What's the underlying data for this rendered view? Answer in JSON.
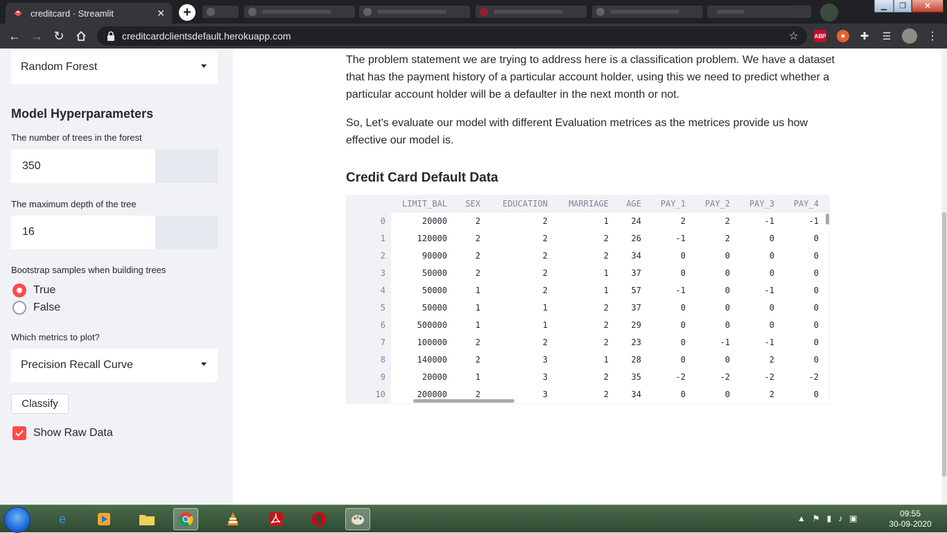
{
  "browser": {
    "tab_title": "creditcard · Streamlit",
    "tab_close": "✕",
    "new_tab": "+",
    "url": "creditcardclientsdefault.herokuapp.com",
    "extensions": {
      "abp": "ABP"
    }
  },
  "sidebar": {
    "classifier_select": "Random Forest",
    "hyperparams_heading": "Model Hyperparameters",
    "trees_label": "The number of trees in the forest",
    "trees_value": "350",
    "depth_label": "The maximum depth of the tree",
    "depth_value": "16",
    "bootstrap_label": "Bootstrap samples when building trees",
    "bootstrap_options": [
      "True",
      "False"
    ],
    "bootstrap_selected": "True",
    "metrics_label": "Which metrics to plot?",
    "metrics_select": "Precision Recall Curve",
    "classify_button": "Classify",
    "show_raw_label": "Show Raw Data",
    "show_raw_checked": true
  },
  "main": {
    "para1": "The problem statement we are trying to address here is a classification problem. We have a dataset that has the payment history of a particular account holder, using this we need to predict whether a particular account holder will be a defaulter in the next month or not.",
    "para2": "So, Let's evaluate our model with different Evaluation metrices as the metrices provide us how effective our model is.",
    "table_title": "Credit Card Default Data",
    "table": {
      "columns": [
        "LIMIT_BAL",
        "SEX",
        "EDUCATION",
        "MARRIAGE",
        "AGE",
        "PAY_1",
        "PAY_2",
        "PAY_3",
        "PAY_4"
      ],
      "index": [
        "0",
        "1",
        "2",
        "3",
        "4",
        "5",
        "6",
        "7",
        "8",
        "9",
        "10"
      ],
      "rows": [
        [
          "20000",
          "2",
          "2",
          "1",
          "24",
          "2",
          "2",
          "-1",
          "-1"
        ],
        [
          "120000",
          "2",
          "2",
          "2",
          "26",
          "-1",
          "2",
          "0",
          "0"
        ],
        [
          "90000",
          "2",
          "2",
          "2",
          "34",
          "0",
          "0",
          "0",
          "0"
        ],
        [
          "50000",
          "2",
          "2",
          "1",
          "37",
          "0",
          "0",
          "0",
          "0"
        ],
        [
          "50000",
          "1",
          "2",
          "1",
          "57",
          "-1",
          "0",
          "-1",
          "0"
        ],
        [
          "50000",
          "1",
          "1",
          "2",
          "37",
          "0",
          "0",
          "0",
          "0"
        ],
        [
          "500000",
          "1",
          "1",
          "2",
          "29",
          "0",
          "0",
          "0",
          "0"
        ],
        [
          "100000",
          "2",
          "2",
          "2",
          "23",
          "0",
          "-1",
          "-1",
          "0"
        ],
        [
          "140000",
          "2",
          "3",
          "1",
          "28",
          "0",
          "0",
          "2",
          "0"
        ],
        [
          "20000",
          "1",
          "3",
          "2",
          "35",
          "-2",
          "-2",
          "-2",
          "-2"
        ],
        [
          "200000",
          "2",
          "3",
          "2",
          "34",
          "0",
          "0",
          "2",
          "0"
        ]
      ]
    }
  },
  "taskbar": {
    "time": "09:55",
    "date": "30-09-2020"
  },
  "colors": {
    "accent": "#ff4b4b",
    "sidebar_bg": "#f0f2f6",
    "text": "#262730"
  }
}
